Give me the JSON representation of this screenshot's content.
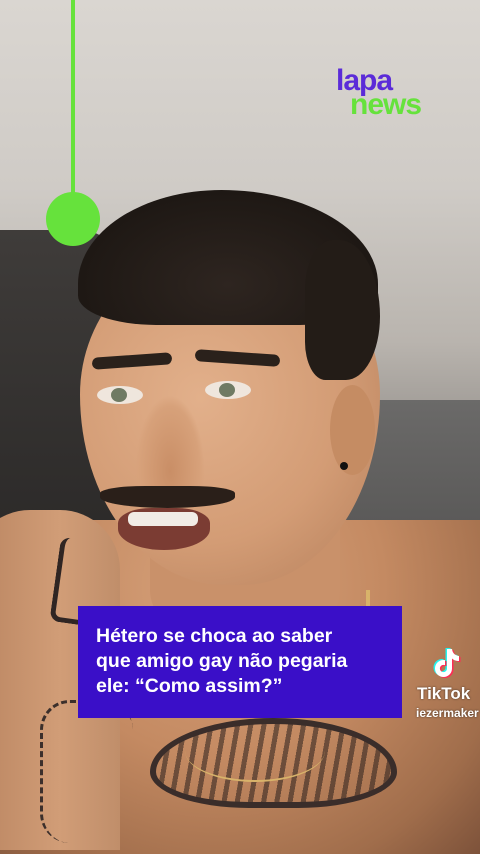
{
  "brand": {
    "logo_top": "lapa",
    "logo_bottom": "news",
    "accent_green": "#66e23c",
    "accent_purple": "#5b2bd8"
  },
  "caption": {
    "lines": [
      "Hétero se choca ao saber",
      "que amigo gay não pegaria",
      "ele: “Como assim?”"
    ],
    "background": "#3a0fc8"
  },
  "tiktok": {
    "icon": "tiktok-icon",
    "label": "TikTok",
    "username": "iezermaker"
  }
}
